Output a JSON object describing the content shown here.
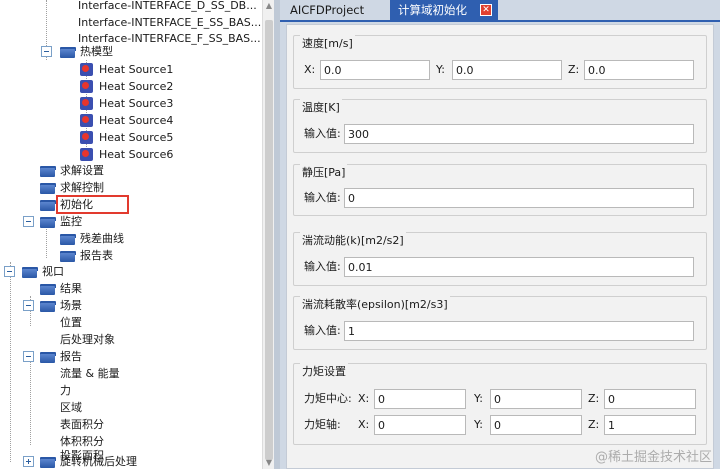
{
  "tree": {
    "interfaces": [
      "Interface-INTERFACE_D_SS_DB...",
      "Interface-INTERFACE_E_SS_BAS...",
      "Interface-INTERFACE_F_SS_BAS..."
    ],
    "thermal_model": "热模型",
    "heat_sources": [
      "Heat Source1",
      "Heat Source2",
      "Heat Source3",
      "Heat Source4",
      "Heat Source5",
      "Heat Source6"
    ],
    "solve_settings": "求解设置",
    "solve_control": "求解控制",
    "initialization": "初始化",
    "monitor": "监控",
    "residual_curve": "残差曲线",
    "report_table": "报告表",
    "viewport": "视口",
    "results": "结果",
    "scene": "场景",
    "position": "位置",
    "post_objects": "后处理对象",
    "report": "报告",
    "flow_energy": "流量 & 能量",
    "force": "力",
    "region": "区域",
    "surface_integral": "表面积分",
    "volume_integral": "体积积分",
    "projected_area": "投影面积",
    "turbo_post": "旋转机械后处理"
  },
  "tabs": {
    "project": "AICFDProject",
    "init": "计算域初始化",
    "close_glyph": "✕"
  },
  "form": {
    "velocity": {
      "title": "速度[m/s]",
      "x_label": "X:",
      "x": "0.0",
      "y_label": "Y:",
      "y": "0.0",
      "z_label": "Z:",
      "z": "0.0"
    },
    "temperature": {
      "title": "温度[K]",
      "label": "输入值:",
      "value": "300"
    },
    "static_pressure": {
      "title": "静压[Pa]",
      "label": "输入值:",
      "value": "0"
    },
    "tke": {
      "title": "湍流动能(k)[m2/s2]",
      "label": "输入值:",
      "value": "0.01"
    },
    "dissipation": {
      "title": "湍流耗散率(epsilon)[m2/s3]",
      "label": "输入值:",
      "value": "1"
    },
    "moment": {
      "title": "力矩设置",
      "center_label": "力矩中心:",
      "axis_label": "力矩轴:",
      "x_label": "X:",
      "y_label": "Y:",
      "z_label": "Z:",
      "center": {
        "x": "0",
        "y": "0",
        "z": "0"
      },
      "axis": {
        "x": "0",
        "y": "0",
        "z": "1"
      }
    }
  },
  "watermark": "@稀土掘金技术社区",
  "colors": {
    "tab_active": "#2f5fb0",
    "highlight": "#e23a2e",
    "panel_bg": "#cfd8e4"
  }
}
